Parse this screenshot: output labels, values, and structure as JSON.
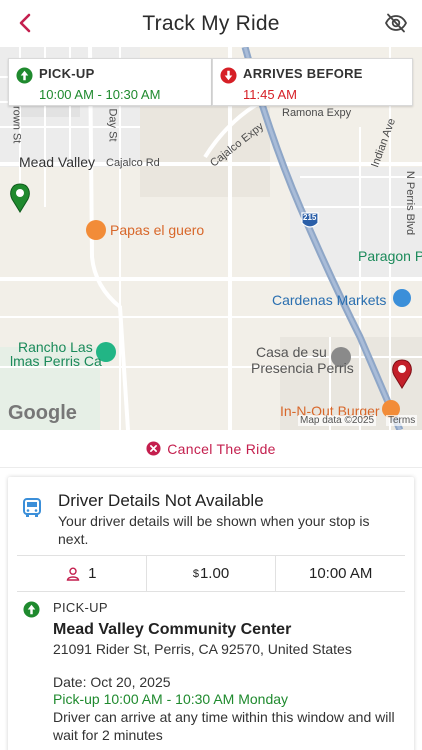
{
  "header": {
    "title": "Track My Ride",
    "back_icon": "chevron-left-icon",
    "privacy_icon": "eye-off-icon",
    "accent": "#c41f4e"
  },
  "map": {
    "pickup_card": {
      "label": "PICK-UP",
      "value": "10:00 AM - 10:30 AM",
      "color": "#1f8a2e"
    },
    "arrive_card": {
      "label": "ARRIVES BEFORE",
      "value": "11:45 AM",
      "color": "#d61f26"
    },
    "places": {
      "mead_valley": "Mead Valley",
      "cajalco_rd": "Cajalco Rd",
      "cajalco_expy": "Cajalco Expy",
      "ramona_expy": "Ramona Expy",
      "indian_ave": "Indian Ave",
      "brown_st": "Brown St",
      "day_st": "Day St",
      "n_perris_blvd": "N Perris Blvd",
      "papas": "Papas el guero",
      "paragon": "Paragon P",
      "cardenas": "Cardenas Markets",
      "rancho_1": "Rancho Las",
      "rancho_2": "lmas Perris Ca",
      "casa_1": "Casa de su",
      "casa_2": "Presencia Perris",
      "innout": "In-N-Out Burger",
      "hwy": "215",
      "google": "Google",
      "map_data": "Map data ©2025",
      "terms": "Terms"
    }
  },
  "cancel": {
    "label": "Cancel The Ride"
  },
  "driver": {
    "title": "Driver Details Not Available",
    "subtitle": "Your driver details will be shown when your stop is next.",
    "passengers": "1",
    "fare_currency": "$",
    "fare": "1.00",
    "time": "10:00 AM"
  },
  "stop": {
    "kind": "PICK-UP",
    "name": "Mead Valley Community Center",
    "address": "21091 Rider St, Perris, CA 92570, United States",
    "date": "Date: Oct 20, 2025",
    "window": "Pick-up 10:00 AM - 10:30 AM Monday",
    "note": "Driver can arrive at any time within this window and will wait for 2 minutes"
  }
}
